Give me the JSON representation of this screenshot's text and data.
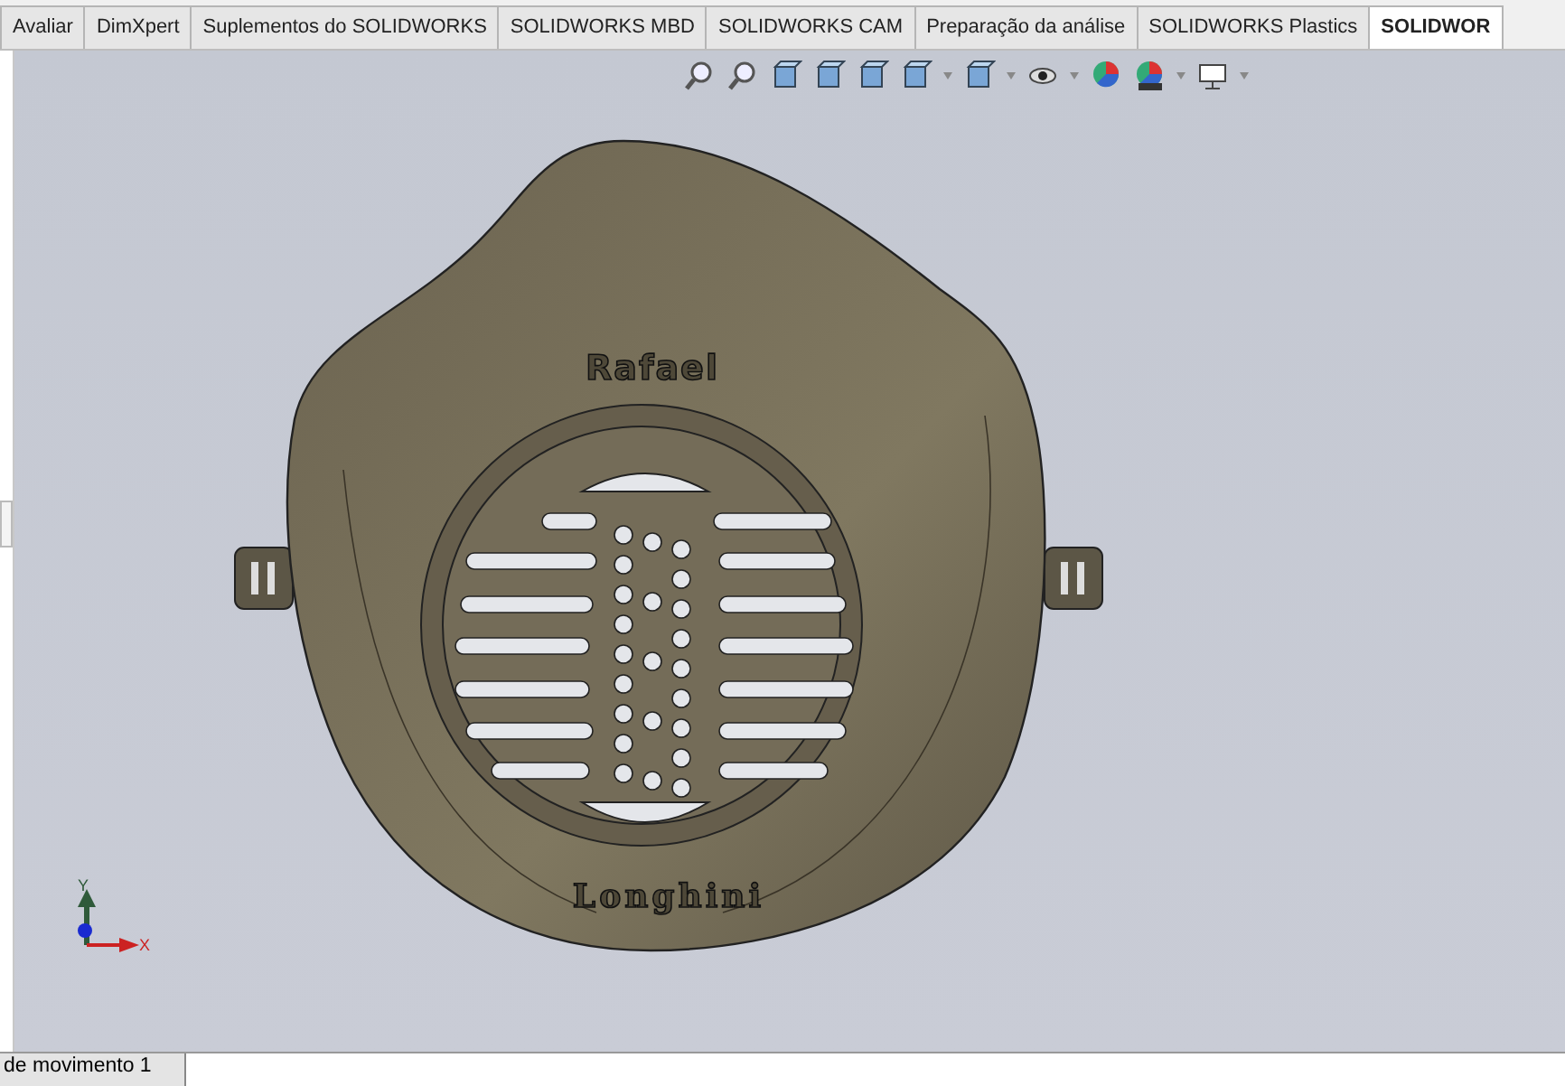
{
  "tabs": [
    {
      "label": "Avaliar",
      "selected": false
    },
    {
      "label": "DimXpert",
      "selected": false
    },
    {
      "label": "Suplementos do SOLIDWORKS",
      "selected": false
    },
    {
      "label": "SOLIDWORKS MBD",
      "selected": false
    },
    {
      "label": "SOLIDWORKS CAM",
      "selected": false
    },
    {
      "label": "Preparação da análise",
      "selected": false
    },
    {
      "label": "SOLIDWORKS Plastics",
      "selected": false
    },
    {
      "label": "SOLIDWOR",
      "selected": true
    }
  ],
  "model": {
    "top_text": "Rafael",
    "bottom_text": "Longhini"
  },
  "triad": {
    "y_label": "Y",
    "x_label": "X"
  },
  "bottom_tabs": [
    {
      "label": "de movimento 1",
      "selected": true
    }
  ]
}
